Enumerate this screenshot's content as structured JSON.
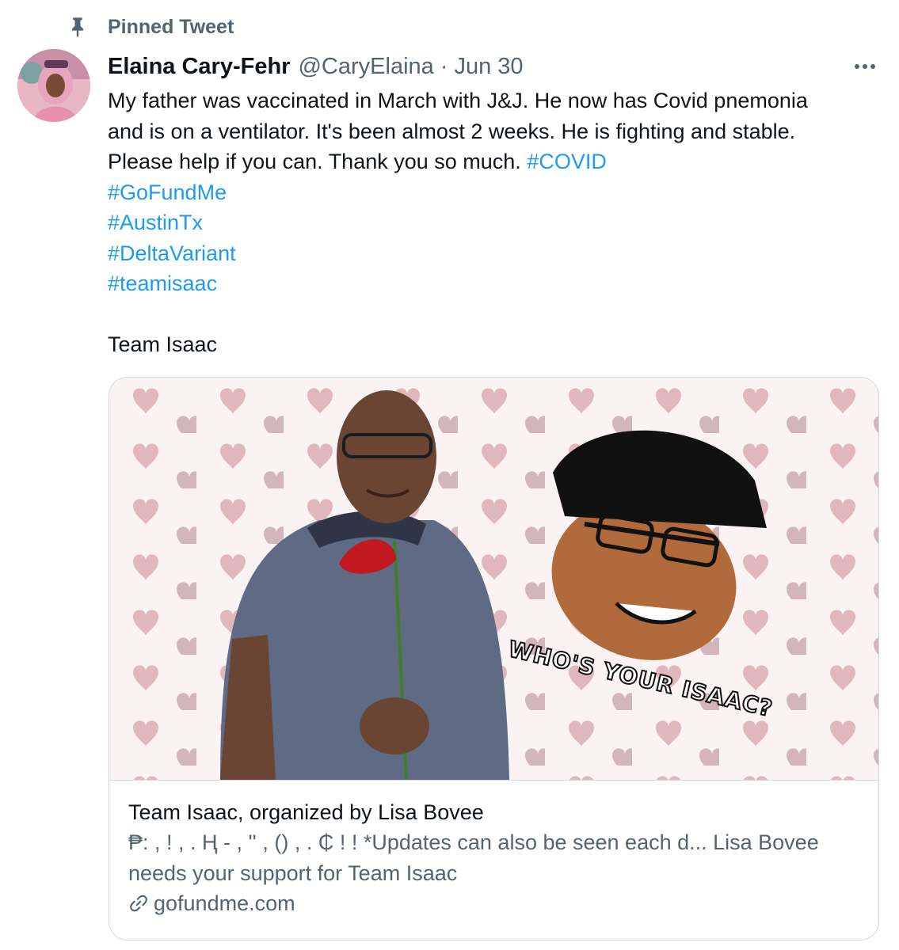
{
  "pinned": {
    "label": "Pinned Tweet",
    "icon": "pin-icon"
  },
  "tweet": {
    "author_name": "Elaina Cary-Fehr",
    "handle": "@CaryElaina",
    "separator": "·",
    "date": "Jun 30",
    "more_icon": "more-icon",
    "text_lines": [
      "My father was vaccinated in March with J&J. He now has Covid pnemonia",
      "and is on a ventilator. It's been almost 2 weeks. He is fighting and stable.",
      "Please help if you can. Thank you so much. "
    ],
    "hashtags": [
      "#COVID",
      "#GoFundMe",
      "#AustinTx",
      "#DeltaVariant",
      "#teamisaac"
    ],
    "closing_line": "Team Isaac"
  },
  "card": {
    "image_caption": "WHO'S YOUR ISAAC?",
    "title": "Team Isaac, organized by Lisa Bovee",
    "description": "₱: , ! , . Ⱨ - , '' , () , . ₵ ! ! *Updates can also be seen each d... Lisa Bovee needs your support for Team Isaac",
    "domain": "gofundme.com",
    "domain_icon": "link-icon"
  },
  "colors": {
    "hashtag": "#1d9bf0",
    "secondary_text": "#536471",
    "primary_text": "#0f1419",
    "card_border": "#cfd9de"
  }
}
